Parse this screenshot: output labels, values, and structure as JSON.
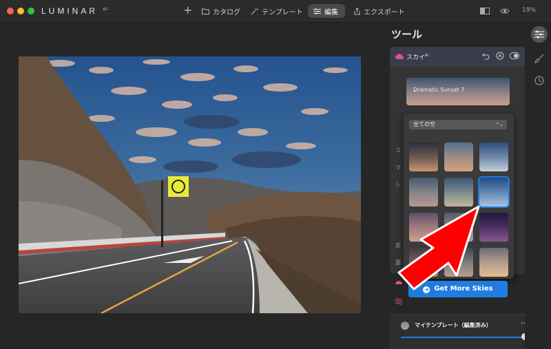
{
  "app": {
    "brand": "LUMINAR",
    "brand_sup": "AI"
  },
  "nav": {
    "catalog": "カタログ",
    "templates": "テンプレート",
    "edit": "編集",
    "export": "エクスポート",
    "zoom": "19%"
  },
  "panel": {
    "title": "ツール",
    "sky_label": "スカイ",
    "sky_label_sup": "AI",
    "selected_sky": "Dramatic Sunset 7",
    "filter_label": "全ての空",
    "get_more": "Get More Skies",
    "template_name": "マイテンプレート（編集済み）"
  },
  "behind_rows": [
    "ス",
    "マ",
    "シ",
    "反",
    "露"
  ],
  "sky_thumbs": [
    {
      "id": "sky-1",
      "colors": [
        "#2a2f3c",
        "#6a5a52",
        "#c89470"
      ]
    },
    {
      "id": "sky-2",
      "colors": [
        "#506f8c",
        "#9f8c84",
        "#d5a27c"
      ]
    },
    {
      "id": "sky-3",
      "colors": [
        "#2e4f7d",
        "#6d86a6",
        "#c4d0dc"
      ]
    },
    {
      "id": "sky-4",
      "colors": [
        "#465a72",
        "#85828a",
        "#b49a8d"
      ]
    },
    {
      "id": "sky-5",
      "colors": [
        "#3a5570",
        "#788a8e",
        "#c7b69d"
      ]
    },
    {
      "id": "sky-6",
      "colors": [
        "#244b83",
        "#5f86b6",
        "#a8c2dc"
      ]
    },
    {
      "id": "sky-7",
      "colors": [
        "#5b4e69",
        "#a07a7c",
        "#d19c8a"
      ]
    },
    {
      "id": "sky-8",
      "colors": [
        "#5a5a62",
        "#86858a",
        "#a8a4a2"
      ]
    },
    {
      "id": "sky-9",
      "colors": [
        "#1b1b3a",
        "#4b2e63",
        "#8b5a8e"
      ]
    },
    {
      "id": "sky-10",
      "colors": [
        "#3e3a40",
        "#75625a",
        "#b08a6a"
      ]
    },
    {
      "id": "sky-11",
      "colors": [
        "#3e4852",
        "#7f7d7b",
        "#b7a08a"
      ]
    },
    {
      "id": "sky-12",
      "colors": [
        "#6c6a78",
        "#b39a8e",
        "#e0bf94"
      ]
    }
  ],
  "colors": {
    "accent": "#1f7ce0",
    "highlight_arrow": "#ff0000"
  }
}
